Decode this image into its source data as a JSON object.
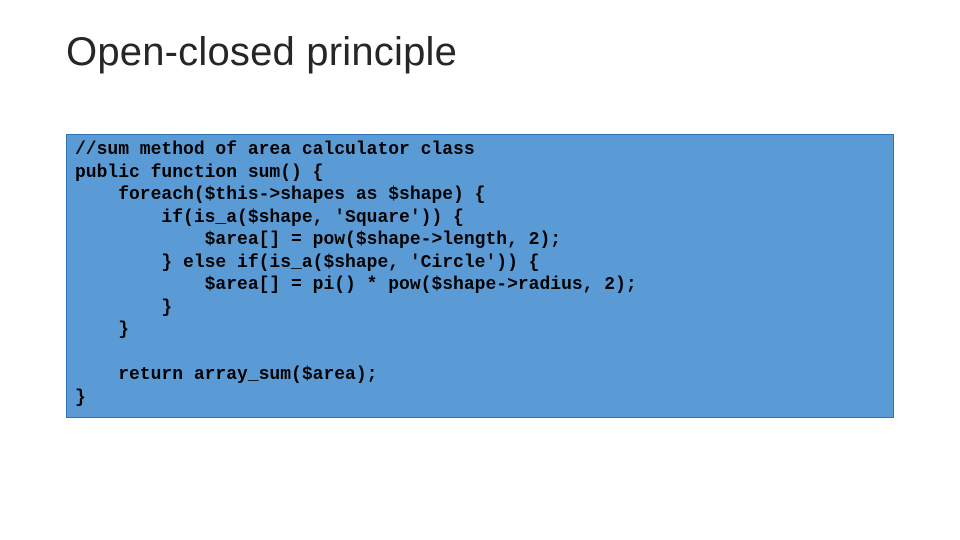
{
  "slide": {
    "title": "Open-closed principle",
    "code": "//sum method of area calculator class\npublic function sum() {\n    foreach($this->shapes as $shape) {\n        if(is_a($shape, 'Square')) {\n            $area[] = pow($shape->length, 2);\n        } else if(is_a($shape, 'Circle')) {\n            $area[] = pi() * pow($shape->radius, 2);\n        }\n    }\n\n    return array_sum($area);\n}"
  }
}
